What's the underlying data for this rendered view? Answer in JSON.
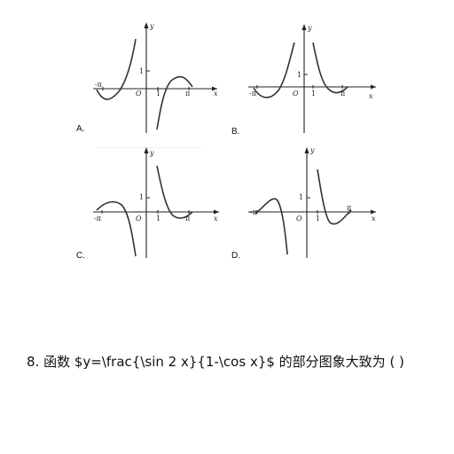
{
  "question": {
    "number": "8.",
    "text": "函数 $y=\\frac{\\sin 2 x}{1-\\cos x}$ 的部分图象大致为 ( )"
  },
  "graphs": [
    {
      "option": "A.",
      "y_label": "y",
      "x_label": "x",
      "origin_label": "O",
      "one_y": "1",
      "one_x": "1",
      "pi": "π",
      "neg_pi": "-π"
    },
    {
      "option": "B.",
      "y_label": "y",
      "x_label": "x",
      "origin_label": "O",
      "one_y": "1",
      "one_x": "1",
      "pi": "π",
      "neg_pi": "-π"
    },
    {
      "option": "C.",
      "y_label": "y",
      "x_label": "x",
      "origin_label": "O",
      "one_y": "1",
      "one_x": "1",
      "pi": "π",
      "neg_pi": "-π"
    },
    {
      "option": "D.",
      "y_label": "y",
      "x_label": "x",
      "origin_label": "O",
      "one_y": "1",
      "one_x": "1",
      "pi": "π",
      "neg_pi": "-π"
    }
  ]
}
